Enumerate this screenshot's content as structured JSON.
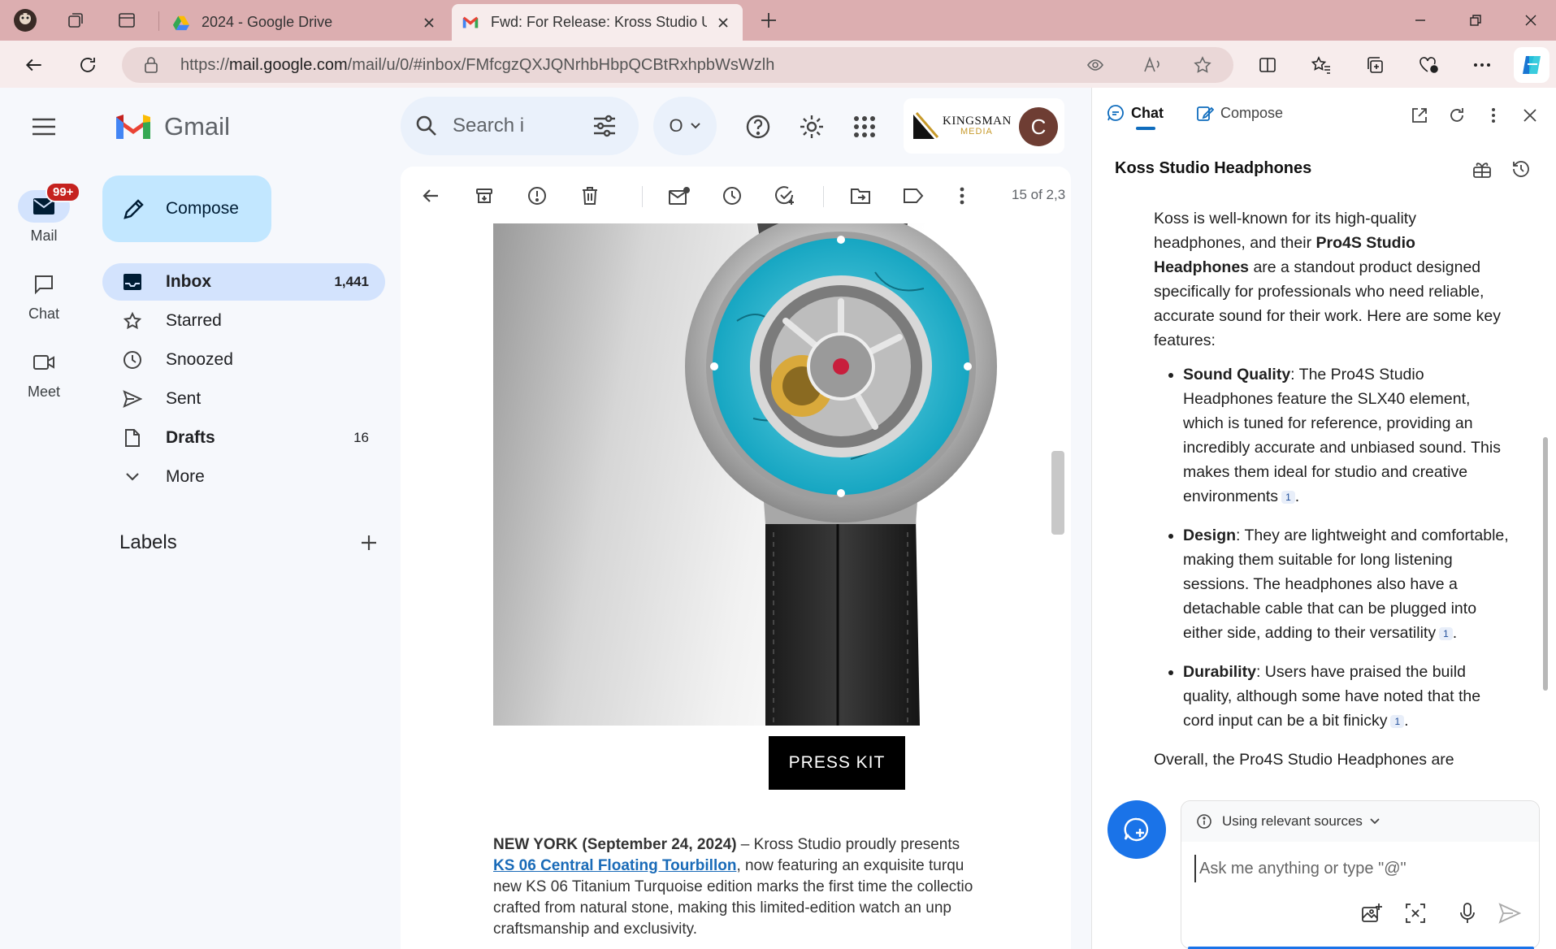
{
  "browser": {
    "tabs": [
      {
        "title": "2024 - Google Drive",
        "active": false
      },
      {
        "title": "Fwd: For Release: Kross Studio Un",
        "active": true
      }
    ],
    "url_scheme": "https://",
    "url_host": "mail.google.com",
    "url_path": "/mail/u/0/#inbox/FMfcgzQXJQNrhbHbpQCBtRxhpbWsWzlh"
  },
  "gmail": {
    "brand": "Gmail",
    "rail": [
      {
        "label": "Mail",
        "badge": "99+"
      },
      {
        "label": "Chat"
      },
      {
        "label": "Meet"
      }
    ],
    "search": {
      "placeholder": "Search i"
    },
    "status": "O",
    "account_logo": {
      "line1": "KINGSMAN",
      "line2": "MEDIA"
    },
    "avatar_letter": "C",
    "compose_label": "Compose",
    "nav": [
      {
        "label": "Inbox",
        "count": "1,441"
      },
      {
        "label": "Starred",
        "count": ""
      },
      {
        "label": "Snoozed",
        "count": ""
      },
      {
        "label": "Sent",
        "count": ""
      },
      {
        "label": "Drafts",
        "count": "16"
      },
      {
        "label": "More",
        "count": ""
      }
    ],
    "labels_title": "Labels",
    "pager": "15 of 2,3"
  },
  "email": {
    "press_kit": "PRESS KIT",
    "dateline": "NEW YORK (September 24, 2024)",
    "line1_rest": " – Kross Studio proudly presents",
    "link": "KS 06 Central Floating Tourbillon",
    "line2_rest": ", now featuring an exquisite turqu",
    "line3": "new KS 06 Titanium Turquoise edition marks the first time the collectio",
    "line4": "crafted from natural stone, making this limited-edition watch an unp",
    "line5": "craftsmanship and exclusivity."
  },
  "copilot": {
    "tabs": {
      "chat": "Chat",
      "compose": "Compose"
    },
    "title": "Koss Studio Headphones",
    "intro_a": "Koss is well-known for its high-quality headphones, and their ",
    "intro_b": "Pro4S Studio Headphones",
    "intro_c": " are a standout product designed specifically for professionals who need reliable, accurate sound for their work. Here are some key features:",
    "features": [
      {
        "name": "Sound Quality",
        "text": ": The Pro4S Studio Headphones feature the SLX40 element, which is tuned for reference, providing an incredibly accurate and unbiased sound. This makes them ideal for studio and creative environments",
        "cite": "1"
      },
      {
        "name": "Design",
        "text": ": They are lightweight and comfortable, making them suitable for long listening sessions. The headphones also have a detachable cable that can be plugged into either side, adding to their versatility",
        "cite": "1"
      },
      {
        "name": "Durability",
        "text": ": Users have praised the build quality, although some have noted that the cord input can be a bit finicky",
        "cite": "1"
      }
    ],
    "outro": "Overall, the Pro4S Studio Headphones are",
    "sources_label": "Using relevant sources",
    "input_placeholder": "Ask me anything or type \"@\""
  },
  "colors": {
    "tabstrip": "#dcaeb0",
    "inbox_active": "#d3e3fd",
    "compose": "#c2e7ff",
    "badge": "#c5221f",
    "link": "#1a6bb8",
    "watch_dial": "#22b3cc"
  }
}
